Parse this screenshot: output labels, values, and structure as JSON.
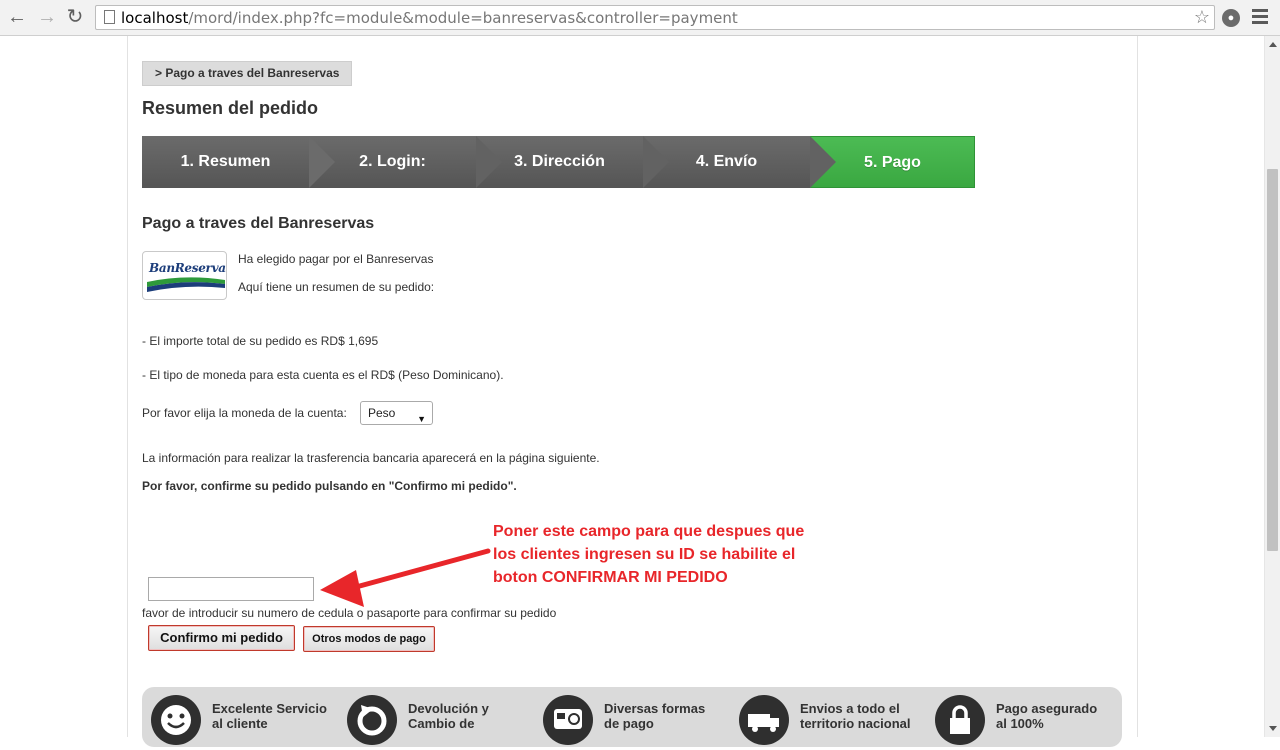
{
  "browser": {
    "url_host": "localhost",
    "url_path": "/mord/index.php?fc=module&module=banreservas&controller=payment"
  },
  "breadcrumb": {
    "label": "> Pago a traves del Banreservas"
  },
  "page_title": "Resumen del pedido",
  "steps": [
    {
      "label": "1. Resumen",
      "active": false
    },
    {
      "label": "2. Login:",
      "active": false
    },
    {
      "label": "3. Dirección",
      "active": false
    },
    {
      "label": "4. Envío",
      "active": false
    },
    {
      "label": "5. Pago",
      "active": true
    }
  ],
  "section_title": "Pago a traves del Banreservas",
  "logo": {
    "text": "BanReservas"
  },
  "intro": {
    "line1": "Ha elegido pagar por el Banreservas",
    "line2": "Aquí tiene un resumen de su pedido:"
  },
  "summary": {
    "total": "- El importe total de su pedido es RD$ 1,695",
    "currency": "- El tipo de moneda para esta cuenta es el RD$ (Peso Dominicano).",
    "choose_currency_label": "Por favor elija la moneda de la cuenta:",
    "currency_selected": "Peso"
  },
  "info_next_page": "La información para realizar la trasferencia bancaria aparecerá en la página siguiente.",
  "confirm_instruction": "Por favor, confirme su pedido pulsando en \"Confirmo mi pedido\".",
  "annotation": {
    "line1": "Poner este campo para que despues que",
    "line2": "los clientes ingresen su ID se habilite el",
    "line3": "boton CONFIRMAR MI PEDIDO"
  },
  "id_input": {
    "value": "",
    "help": "favor de introducir su numero de cedula o pasaporte para confirmar su pedido"
  },
  "buttons": {
    "confirm": "Confirmo mi pedido",
    "other": "Otros modos de pago"
  },
  "features": [
    {
      "line1": "Excelente Servicio",
      "line2": "al cliente",
      "icon": "smiley-icon"
    },
    {
      "line1": "Devolución y",
      "line2": "Cambio de",
      "icon": "refresh-icon"
    },
    {
      "line1": "Diversas formas",
      "line2": "de pago",
      "icon": "card-icon"
    },
    {
      "line1": "Envios a todo el",
      "line2": "territorio nacional",
      "icon": "truck-icon"
    },
    {
      "line1": "Pago asegurado",
      "line2": "al 100%",
      "icon": "lock-icon"
    }
  ],
  "colors": {
    "step_active": "#3aa841",
    "step_inactive": "#5f5f5f",
    "annotation": "#e8262a",
    "button_border": "#c0392b"
  }
}
